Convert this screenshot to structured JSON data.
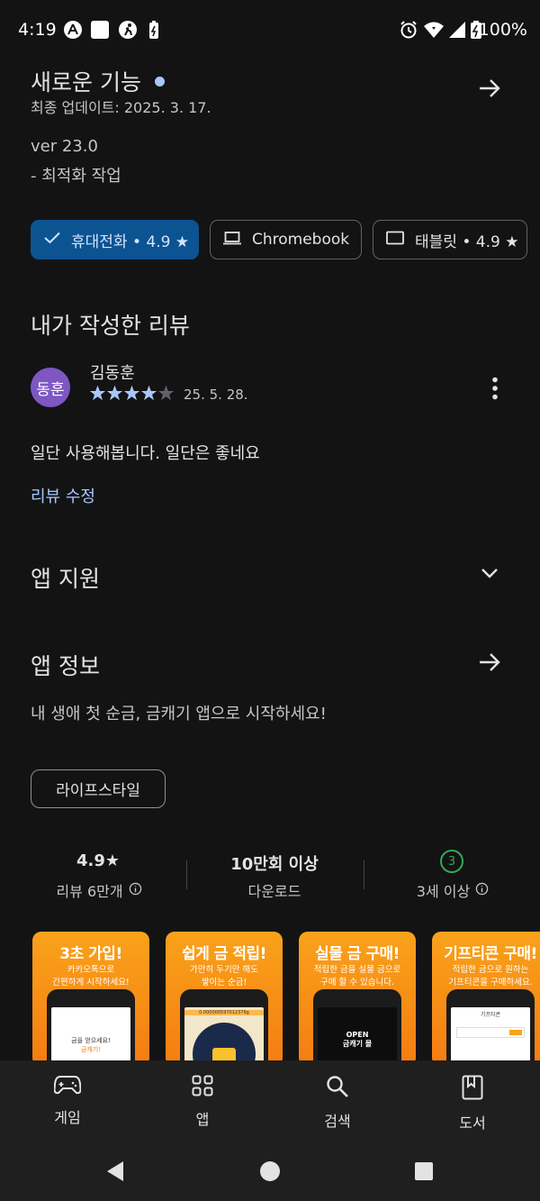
{
  "status_bar": {
    "time": "4:19",
    "battery": "100%"
  },
  "whats_new": {
    "title": "새로운 기능",
    "updated": "최종 업데이트: 2025. 3. 17.",
    "version": "ver 23.0",
    "note": "- 최적화 작업"
  },
  "device_chips": [
    {
      "label": "휴대전화 • 4.9 ★",
      "icon": "check-icon"
    },
    {
      "label": "Chromebook",
      "icon": "laptop-icon"
    },
    {
      "label": "태블릿 • 4.9 ★",
      "icon": "tablet-icon"
    }
  ],
  "my_review": {
    "heading": "내가 작성한 리뷰",
    "avatar_text": "동훈",
    "reviewer": "김동훈",
    "stars": 4,
    "date": "25. 5. 28.",
    "text": "일단 사용해봅니다. 일단은 좋네요",
    "edit_label": "리뷰 수정"
  },
  "app_support": {
    "title": "앱 지원"
  },
  "app_info": {
    "title": "앱 정보",
    "description": "내 생애 첫 순금, 금캐기 앱으로 시작하세요!",
    "category": "라이프스타일"
  },
  "stats": {
    "rating": "4.9★",
    "reviews": "리뷰 6만개",
    "downloads": "10만회 이상",
    "downloads_label": "다운로드",
    "age_badge": "3",
    "age_label": "3세 이상"
  },
  "screenshots": [
    {
      "title": "3초 가입!",
      "line1": "카카오톡으로",
      "line2": "간편하게 시작하세요!",
      "screen1": "금을 얻으세요!",
      "screen2": "금캐기!"
    },
    {
      "title": "쉽게 금 적립!",
      "line1": "가만히 두기만 해도",
      "line2": "쌓이는 순금!",
      "screen1": "0.000000597012379g",
      "screen2": ""
    },
    {
      "title": "실물 금 구매!",
      "line1": "적립한 금을 실물 금으로",
      "line2": "구매 할 수 있습니다.",
      "screen1": "OPEN",
      "screen2": "금캐기 몰"
    },
    {
      "title": "기프티콘 구매!",
      "line1": "적립한 금으로 원하는",
      "line2": "기프티콘을 구매하세요.",
      "screen1": "기프티콘",
      "screen2": ""
    }
  ],
  "bottom_nav": [
    {
      "label": "게임",
      "icon": "gamepad-icon"
    },
    {
      "label": "앱",
      "icon": "apps-grid-icon"
    },
    {
      "label": "검색",
      "icon": "search-icon"
    },
    {
      "label": "도서",
      "icon": "book-icon"
    }
  ],
  "colors": {
    "accent_blue": "#a8c7fa",
    "chip_selected": "#0b5391",
    "avatar": "#7e57c2",
    "star": "#a8c7fa",
    "age_green": "#34a853"
  }
}
